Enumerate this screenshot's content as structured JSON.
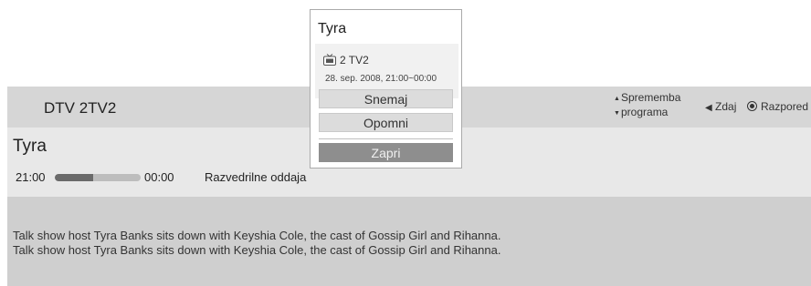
{
  "header": {
    "channel": "DTV 2TV2",
    "change_program_line1": "Sprememba",
    "change_program_line2": "programa",
    "back_label": "Zdaj",
    "schedule_label": "Razpored"
  },
  "program": {
    "title": "Tyra",
    "start_time": "21:00",
    "end_time": "00:00",
    "progress": 0.45,
    "genre": "Razvedrilne oddaja",
    "description_lines": [
      "Talk show host Tyra Banks sits down with Keyshia Cole, the cast of Gossip Girl and Rihanna.",
      "Talk show host Tyra Banks sits down with Keyshia Cole, the cast of Gossip Girl and Rihanna."
    ]
  },
  "popup": {
    "title": "Tyra",
    "channel": "2 TV2",
    "date_time": "28. sep. 2008, 21:00~00:00",
    "buttons": [
      "Snemaj",
      "Opomni"
    ],
    "close_label": "Zapri"
  },
  "icons": {
    "tv": "tv-icon",
    "up_down_arrows": "up-down-arrow-icon",
    "back": "left-triangle-icon",
    "schedule": "radio-dot-icon"
  },
  "colors": {
    "header_bg": "#d6d6d6",
    "info_bg": "#e8e8e8",
    "desc_bg": "#cfcfcf",
    "button_bg": "#dcdcdc",
    "close_bg": "#8e8e8e"
  }
}
